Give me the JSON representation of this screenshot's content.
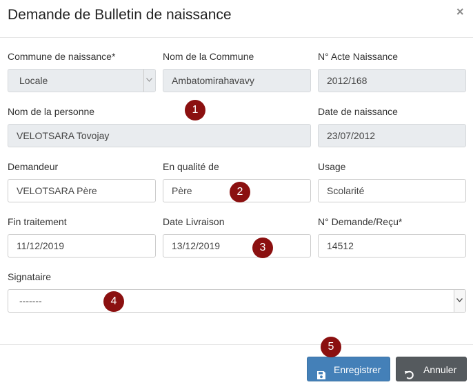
{
  "dialog": {
    "title": "Demande de Bulletin de naissance",
    "close_label": "×"
  },
  "fields": {
    "commune_naissance": {
      "label": "Commune de naissance*",
      "value": "Locale"
    },
    "nom_commune": {
      "label": "Nom de la Commune",
      "value": "Ambatomirahavavy"
    },
    "acte_naissance": {
      "label": "N° Acte Naissance",
      "value": "2012/168"
    },
    "nom_personne": {
      "label": "Nom de la personne",
      "value": "VELOTSARA Tovojay"
    },
    "date_naissance": {
      "label": "Date de naissance",
      "value": "23/07/2012"
    },
    "demandeur": {
      "label": "Demandeur",
      "value": "VELOTSARA Père"
    },
    "qualite": {
      "label": "En qualité de",
      "value": "Père"
    },
    "usage": {
      "label": "Usage",
      "value": "Scolarité"
    },
    "fin_traitement": {
      "label": "Fin traitement",
      "value": "11/12/2019"
    },
    "date_livraison": {
      "label": "Date Livraison",
      "value": "13/12/2019"
    },
    "demande_recu": {
      "label": "N° Demande/Reçu*",
      "value": "14512"
    },
    "signataire": {
      "label": "Signataire",
      "value": "-------"
    }
  },
  "markers": [
    "1",
    "2",
    "3",
    "4",
    "5"
  ],
  "buttons": {
    "save_label": "Enregistrer",
    "cancel_label": "Annuler"
  },
  "colors": {
    "marker": "#8b1010",
    "save_button": "#4480b8",
    "cancel_button": "#555a5e",
    "readonly_field": "#e9ecef"
  }
}
